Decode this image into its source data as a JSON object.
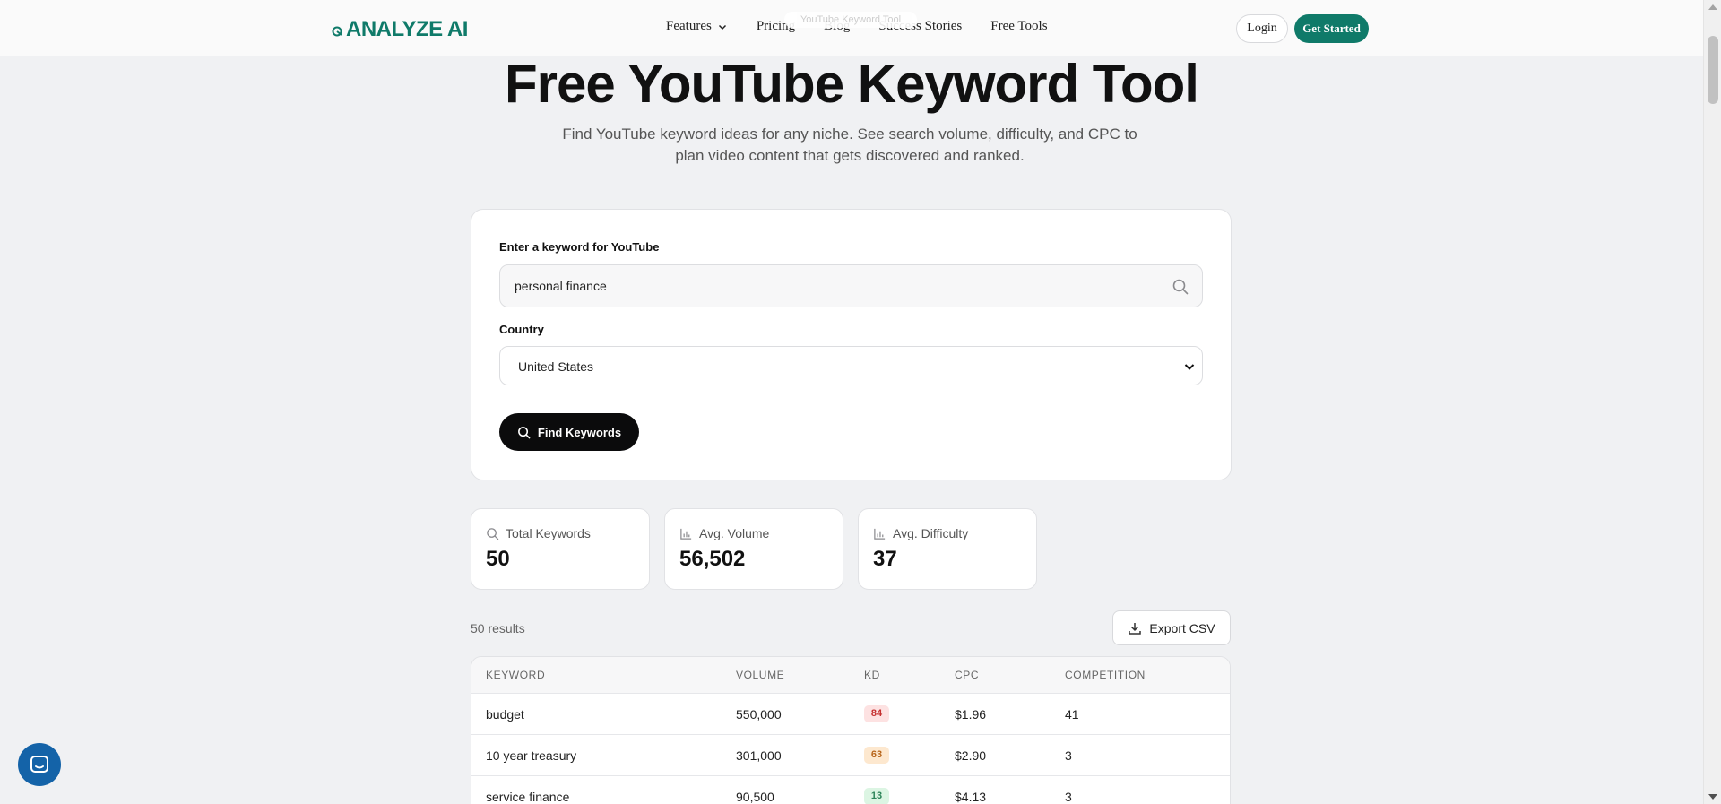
{
  "nav": {
    "logo_text": "ANALYZE AI",
    "links": [
      "Features",
      "Pricing",
      "Blog",
      "Success Stories",
      "Free Tools"
    ],
    "ghost_tag": "YouTube Keyword Tool",
    "login_label": "Login",
    "get_started_label": "Get Started"
  },
  "hero": {
    "title": "Free YouTube Keyword Tool",
    "subtitle": "Find YouTube keyword ideas for any niche. See search volume, difficulty, and CPC to plan video content that gets discovered and ranked."
  },
  "search": {
    "keyword_label": "Enter a keyword for YouTube",
    "keyword_value": "personal finance",
    "country_label": "Country",
    "country_value": "United States",
    "button_label": "Find Keywords"
  },
  "stats": [
    {
      "label": "Total Keywords",
      "value": "50",
      "icon": "search-icon"
    },
    {
      "label": "Avg. Volume",
      "value": "56,502",
      "icon": "bar-chart-icon"
    },
    {
      "label": "Avg. Difficulty",
      "value": "37",
      "icon": "bar-chart-icon"
    }
  ],
  "results": {
    "count_text": "50 results",
    "export_label": "Export CSV"
  },
  "table": {
    "headers": [
      "KEYWORD",
      "VOLUME",
      "KD",
      "CPC",
      "COMPETITION"
    ],
    "rows": [
      {
        "keyword": "budget",
        "volume": "550,000",
        "kd": "84",
        "cpc": "$1.96",
        "competition": "41"
      },
      {
        "keyword": "10 year treasury",
        "volume": "301,000",
        "kd": "63",
        "cpc": "$2.90",
        "competition": "3"
      },
      {
        "keyword": "service finance",
        "volume": "90,500",
        "kd": "13",
        "cpc": "$4.13",
        "competition": "3"
      }
    ]
  },
  "colors": {
    "brand": "#0f7a69",
    "kd_high_bg": "#fde2e2",
    "kd_high_fg": "#c53030",
    "kd_mid_bg": "#fde8cf",
    "kd_mid_fg": "#b7651b",
    "kd_low_bg": "#dcf5e3",
    "kd_low_fg": "#2f855a",
    "chat": "#1463a8"
  }
}
